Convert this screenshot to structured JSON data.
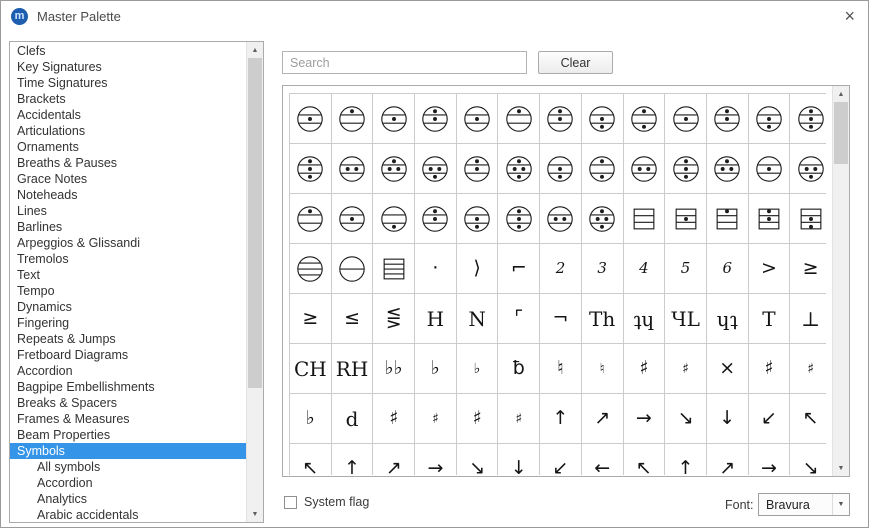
{
  "window": {
    "title": "Master Palette",
    "close_glyph": "×"
  },
  "icons": {
    "logo_glyph": "m",
    "scroll_up": "▲",
    "scroll_down": "▼",
    "dropdown_arrow": "▼"
  },
  "sidebar": {
    "items": [
      {
        "label": "Clefs"
      },
      {
        "label": "Key Signatures"
      },
      {
        "label": "Time Signatures"
      },
      {
        "label": "Brackets"
      },
      {
        "label": "Accidentals"
      },
      {
        "label": "Articulations"
      },
      {
        "label": "Ornaments"
      },
      {
        "label": "Breaths & Pauses"
      },
      {
        "label": "Grace Notes"
      },
      {
        "label": "Noteheads"
      },
      {
        "label": "Lines"
      },
      {
        "label": "Barlines"
      },
      {
        "label": "Arpeggios & Glissandi"
      },
      {
        "label": "Tremolos"
      },
      {
        "label": "Text"
      },
      {
        "label": "Tempo"
      },
      {
        "label": "Dynamics"
      },
      {
        "label": "Fingering"
      },
      {
        "label": "Repeats & Jumps"
      },
      {
        "label": "Fretboard Diagrams"
      },
      {
        "label": "Accordion"
      },
      {
        "label": "Bagpipe Embellishments"
      },
      {
        "label": "Breaks & Spacers"
      },
      {
        "label": "Frames & Measures"
      },
      {
        "label": "Beam Properties"
      },
      {
        "label": "Symbols",
        "selected": true
      },
      {
        "label": "All symbols",
        "indent": true
      },
      {
        "label": "Accordion",
        "indent": true
      },
      {
        "label": "Analytics",
        "indent": true
      },
      {
        "label": "Arabic accidentals",
        "indent": true
      }
    ]
  },
  "search": {
    "placeholder": "Search",
    "value": "",
    "clear_label": "Clear"
  },
  "grid": {
    "columns": 13,
    "visible_rows": 8,
    "rows": [
      [
        {
          "k": "r",
          "d": [
            "m"
          ]
        },
        {
          "k": "r",
          "d": [
            "t"
          ]
        },
        {
          "k": "r",
          "d": [
            "m"
          ]
        },
        {
          "k": "r",
          "d": [
            "t",
            "m"
          ]
        },
        {
          "k": "r",
          "d": [
            "m"
          ]
        },
        {
          "k": "r",
          "d": [
            "t"
          ]
        },
        {
          "k": "r",
          "d": [
            "t",
            "m"
          ]
        },
        {
          "k": "r",
          "d": [
            "m",
            "b"
          ]
        },
        {
          "k": "r",
          "d": [
            "t",
            "b"
          ]
        },
        {
          "k": "r",
          "d": [
            "m"
          ]
        },
        {
          "k": "r",
          "d": [
            "t",
            "m"
          ]
        },
        {
          "k": "r",
          "d": [
            "m",
            "b"
          ]
        },
        {
          "k": "r",
          "d": [
            "t",
            "m",
            "b"
          ]
        }
      ],
      [
        {
          "k": "r",
          "d": [
            "t",
            "m",
            "b"
          ]
        },
        {
          "k": "r",
          "d": [
            "ml",
            "mr"
          ]
        },
        {
          "k": "r",
          "d": [
            "t",
            "ml",
            "mr"
          ]
        },
        {
          "k": "r",
          "d": [
            "ml",
            "mr",
            "b"
          ]
        },
        {
          "k": "r",
          "d": [
            "t",
            "m"
          ]
        },
        {
          "k": "r",
          "d": [
            "t",
            "ml",
            "mr",
            "b"
          ]
        },
        {
          "k": "r",
          "d": [
            "m",
            "b"
          ]
        },
        {
          "k": "r",
          "d": [
            "t",
            "b"
          ]
        },
        {
          "k": "r",
          "d": [
            "ml",
            "mr"
          ]
        },
        {
          "k": "r",
          "d": [
            "t",
            "m",
            "b"
          ]
        },
        {
          "k": "r",
          "d": [
            "t",
            "ml",
            "mr"
          ]
        },
        {
          "k": "r",
          "d": [
            "m"
          ]
        },
        {
          "k": "r",
          "d": [
            "ml",
            "mr",
            "b"
          ]
        }
      ],
      [
        {
          "k": "r",
          "d": [
            "t"
          ]
        },
        {
          "k": "r",
          "d": [
            "m"
          ]
        },
        {
          "k": "r",
          "d": [
            "b"
          ]
        },
        {
          "k": "r",
          "d": [
            "t",
            "m"
          ]
        },
        {
          "k": "r",
          "d": [
            "m",
            "b"
          ]
        },
        {
          "k": "r",
          "d": [
            "t",
            "m",
            "b"
          ]
        },
        {
          "k": "r",
          "d": [
            "ml",
            "mr"
          ]
        },
        {
          "k": "r",
          "d": [
            "t",
            "ml",
            "mr",
            "b"
          ]
        },
        {
          "k": "s",
          "d": []
        },
        {
          "k": "s",
          "d": [
            "m"
          ]
        },
        {
          "k": "s",
          "d": [
            "t"
          ]
        },
        {
          "k": "s",
          "d": [
            "t",
            "m"
          ]
        },
        {
          "k": "s",
          "d": [
            "m",
            "b"
          ]
        }
      ],
      [
        {
          "k": "r",
          "l": 3,
          "d": []
        },
        {
          "k": "r",
          "l": 1,
          "d": []
        },
        {
          "k": "s",
          "l": 3,
          "d": []
        },
        {
          "k": "t",
          "g": "·"
        },
        {
          "k": "t",
          "g": "⟩"
        },
        {
          "k": "t",
          "g": "⌐"
        },
        {
          "k": "t",
          "g": "2",
          "c": "num"
        },
        {
          "k": "t",
          "g": "3",
          "c": "num"
        },
        {
          "k": "t",
          "g": "4",
          "c": "num"
        },
        {
          "k": "t",
          "g": "5",
          "c": "num"
        },
        {
          "k": "t",
          "g": "6",
          "c": "num"
        },
        {
          "k": "t",
          "g": ">"
        },
        {
          "k": "t",
          "g": "≥"
        }
      ],
      [
        {
          "k": "t",
          "g": "≥"
        },
        {
          "k": "t",
          "g": "≤"
        },
        {
          "k": "t",
          "g": "⋚"
        },
        {
          "k": "t",
          "g": "H",
          "c": "big"
        },
        {
          "k": "t",
          "g": "N",
          "c": "big"
        },
        {
          "k": "t",
          "g": "⌜"
        },
        {
          "k": "t",
          "g": "¬"
        },
        {
          "k": "t",
          "g": "Th",
          "c": "big"
        },
        {
          "k": "t",
          "g": "ʇɥ",
          "c": "big"
        },
        {
          "k": "t",
          "g": "ЧL",
          "c": "big"
        },
        {
          "k": "t",
          "g": "ɥʇ",
          "c": "big"
        },
        {
          "k": "t",
          "g": "T",
          "c": "big"
        },
        {
          "k": "t",
          "g": "⊥",
          "c": "big"
        }
      ],
      [
        {
          "k": "t",
          "g": "CH",
          "c": "big"
        },
        {
          "k": "t",
          "g": "RH",
          "c": "big"
        },
        {
          "k": "t",
          "g": "♭♭"
        },
        {
          "k": "t",
          "g": "♭"
        },
        {
          "k": "t",
          "g": "♭",
          "c": "sm"
        },
        {
          "k": "t",
          "g": "ƀ"
        },
        {
          "k": "t",
          "g": "♮"
        },
        {
          "k": "t",
          "g": "♮",
          "c": "sm"
        },
        {
          "k": "t",
          "g": "♯"
        },
        {
          "k": "t",
          "g": "♯",
          "c": "sm"
        },
        {
          "k": "t",
          "g": "×"
        },
        {
          "k": "t",
          "g": "♯"
        },
        {
          "k": "t",
          "g": "♯",
          "c": "sm"
        }
      ],
      [
        {
          "k": "t",
          "g": "♭"
        },
        {
          "k": "t",
          "g": "d",
          "c": "big"
        },
        {
          "k": "t",
          "g": "♯"
        },
        {
          "k": "t",
          "g": "♯",
          "c": "sm"
        },
        {
          "k": "t",
          "g": "♯"
        },
        {
          "k": "t",
          "g": "♯",
          "c": "sm"
        },
        {
          "k": "t",
          "g": "↑"
        },
        {
          "k": "t",
          "g": "↗"
        },
        {
          "k": "t",
          "g": "→"
        },
        {
          "k": "t",
          "g": "↘"
        },
        {
          "k": "t",
          "g": "↓"
        },
        {
          "k": "t",
          "g": "↙"
        },
        {
          "k": "t",
          "g": "↖"
        }
      ],
      [
        {
          "k": "t",
          "g": "↖"
        },
        {
          "k": "t",
          "g": "↑"
        },
        {
          "k": "t",
          "g": "↗"
        },
        {
          "k": "t",
          "g": "→"
        },
        {
          "k": "t",
          "g": "↘"
        },
        {
          "k": "t",
          "g": "↓"
        },
        {
          "k": "t",
          "g": "↙"
        },
        {
          "k": "t",
          "g": "←"
        },
        {
          "k": "t",
          "g": "↖"
        },
        {
          "k": "t",
          "g": "↑"
        },
        {
          "k": "t",
          "g": "↗"
        },
        {
          "k": "t",
          "g": "→"
        },
        {
          "k": "t",
          "g": "↘"
        }
      ]
    ]
  },
  "footer": {
    "system_flag_label": "System flag",
    "system_flag_checked": false,
    "font_label": "Font:",
    "font_value": "Bravura"
  }
}
